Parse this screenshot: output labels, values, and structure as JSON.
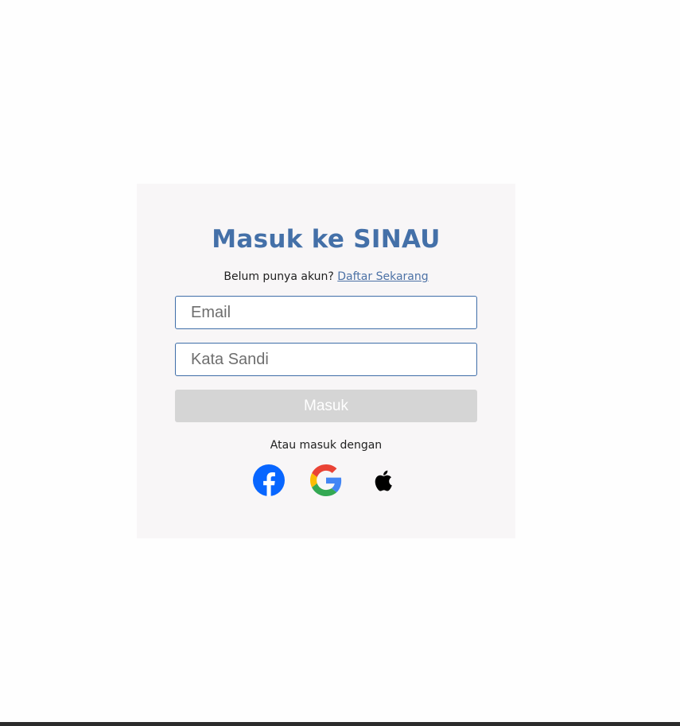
{
  "login": {
    "title": "Masuk ke SINAU",
    "signup_prompt": "Belum punya akun?",
    "signup_link": "Daftar Sekarang",
    "email_placeholder": "Email",
    "password_placeholder": "Kata Sandi",
    "submit_label": "Masuk",
    "alt_login_text": "Atau masuk dengan",
    "social": [
      {
        "icon": "facebook-icon"
      },
      {
        "icon": "google-icon"
      },
      {
        "icon": "apple-icon"
      }
    ]
  },
  "colors": {
    "title": "#4470a8",
    "link": "#4d72a6",
    "card_background": "#f8f6f7",
    "input_border": "#3f6ea8",
    "button_background": "#d5d5d5",
    "button_text": "#ffffff",
    "facebook": "#0866ff"
  }
}
